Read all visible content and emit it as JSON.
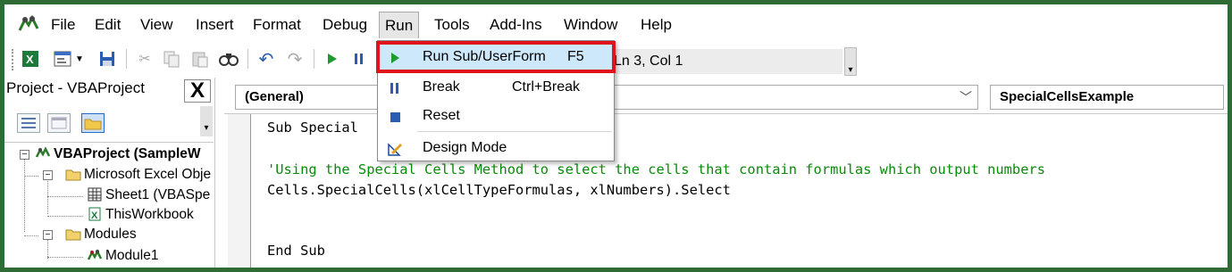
{
  "menubar": {
    "items": [
      {
        "id": "file",
        "label": "File"
      },
      {
        "id": "edit",
        "label": "Edit"
      },
      {
        "id": "view",
        "label": "View"
      },
      {
        "id": "insert",
        "label": "Insert"
      },
      {
        "id": "format",
        "label": "Format"
      },
      {
        "id": "debug",
        "label": "Debug"
      },
      {
        "id": "run",
        "label": "Run"
      },
      {
        "id": "tools",
        "label": "Tools"
      },
      {
        "id": "addins",
        "label": "Add-Ins"
      },
      {
        "id": "window",
        "label": "Window"
      },
      {
        "id": "help",
        "label": "Help"
      }
    ]
  },
  "toolbar": {
    "position_text": "Ln 3, Col 1"
  },
  "run_menu": {
    "items": [
      {
        "label": "Run Sub/UserForm",
        "shortcut": "F5",
        "icon": "play-icon"
      },
      {
        "label": "Break",
        "shortcut": "Ctrl+Break",
        "icon": "pause-icon"
      },
      {
        "label": "Reset",
        "shortcut": "",
        "icon": "stop-icon"
      },
      {
        "label": "Design Mode",
        "shortcut": "",
        "icon": "design-mode-icon"
      }
    ]
  },
  "project": {
    "title": "Project - VBAProject",
    "close_label": "X",
    "tree": [
      {
        "label": "VBAProject (SampleW",
        "icon": "vbaproject-icon"
      },
      {
        "label": "Microsoft Excel Obje",
        "icon": "folder-icon"
      },
      {
        "label": "Sheet1 (VBASpe",
        "icon": "sheet-icon"
      },
      {
        "label": "ThisWorkbook",
        "icon": "workbook-icon"
      },
      {
        "label": "Modules",
        "icon": "folder-icon"
      },
      {
        "label": "Module1",
        "icon": "module-icon"
      }
    ]
  },
  "code": {
    "object_combo": "(General)",
    "procedure_combo": "SpecialCellsExample",
    "lines": [
      "Sub Special",
      "'Using the Special Cells Method to select the cells that contain formulas which output numbers",
      "Cells.SpecialCells(xlCellTypeFormulas, xlNumbers).Select",
      "End Sub"
    ]
  },
  "colors": {
    "frame": "#2f6b35",
    "comment": "#0a8a0a",
    "highlight_border": "#e0131c",
    "highlight_fill": "#cde8fa"
  }
}
